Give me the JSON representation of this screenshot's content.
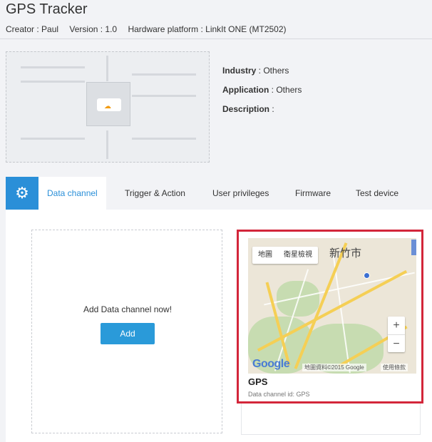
{
  "header": {
    "title": "GPS Tracker",
    "creator": "Creator : Paul",
    "version": "Version : 1.0",
    "platform": "Hardware platform : LinkIt ONE (MT2502)"
  },
  "info": {
    "industry_label": "Industry",
    "industry_value": " : Others",
    "application_label": "Application",
    "application_value": " : Others",
    "description_label": "Description",
    "description_value": " :"
  },
  "tabs": [
    {
      "label": "Data channel",
      "active": true
    },
    {
      "label": "Trigger & Action"
    },
    {
      "label": "User privileges"
    },
    {
      "label": "Firmware"
    },
    {
      "label": "Test device"
    }
  ],
  "add_channel": {
    "text": "Add Data channel now!",
    "button": "Add"
  },
  "channel_card": {
    "name": "GPS",
    "sub": "Data channel id: GPS",
    "map": {
      "btn_map": "地圖",
      "btn_satellite": "衛星檢視",
      "city": "新竹市",
      "zoom_in": "+",
      "zoom_out": "−",
      "logo": "Google",
      "attribution": "地圖資料©2015 Google",
      "terms": "使用條款"
    }
  },
  "icons": {
    "settings": "gears-icon",
    "cloud": "cloud-icon"
  },
  "colors": {
    "accent": "#2a8fd8",
    "highlight": "#d3263a"
  }
}
